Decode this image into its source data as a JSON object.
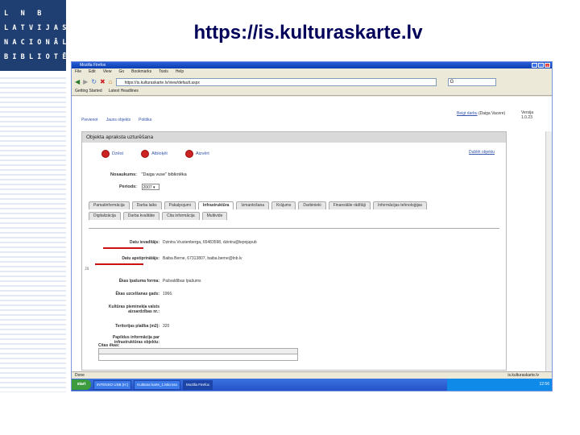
{
  "slide": {
    "title": "https://is.kulturaskarte.lv",
    "logo_lines": [
      "L N B",
      "LATVIJAS",
      "NACIONĀLĀ",
      "BIBLIOTĒKA"
    ]
  },
  "browser": {
    "window_title": "Mozilla Firefox",
    "menu": [
      "File",
      "Edit",
      "View",
      "Go",
      "Bookmarks",
      "Tools",
      "Help"
    ],
    "url": "https://is.kulturaskarte.lv/view/default.aspx",
    "search_placeholder": "G",
    "bookmarks": [
      "Getting Started",
      "Latest Headlines"
    ],
    "status_left": "Done",
    "status_right": "is.kulturaskarte.lv"
  },
  "page": {
    "nav_links": [
      "Pievienot",
      "Jauns objekts",
      "Politika"
    ],
    "user_logout": "Beigt darbu",
    "user_name": "(Daiga Vacere)",
    "version_label": "Versija",
    "version_value": "1.0.23",
    "panel_title": "Objekta apraksta uzturēšana",
    "actions": [
      "Dzēst",
      "Atbloķēt",
      "Aizvērt"
    ],
    "close_link": "Dublēt objektu",
    "name_label": "Nosaukums:",
    "name_value": "\"Daiga vuse\" bibliotēka",
    "period_label": "Periods:",
    "period_value": "2007",
    "tabs_row1": [
      "Pamatinformācija",
      "Darba laiks",
      "Pakalpojumi",
      "Infrastruktūra",
      "Izmantošana",
      "Krājums",
      "Darbinieki",
      "Finansiālie rādītāji",
      "Informācijas tehnoloģijas"
    ],
    "tabs_row2": [
      "Digitalizācija",
      "Darba kvalitāte",
      "Cita informācija",
      "Multivide"
    ],
    "active_tab": "Infrastruktūra",
    "fields": [
      {
        "label": "Datu ievadītājs:",
        "value": "Dzintra Vrustenberga, 65483598, dzintra@lepojupub"
      },
      {
        "label": "Datu apstiprinātājs:",
        "value": "Baiba Berne, 67313807, baiba.berne@lnb.lv"
      },
      {
        "label": "Ēkas īpašuma forma:",
        "value": "Pašvaldības īpašums"
      },
      {
        "label": "Ēkas uzcelšanas gads:",
        "value": "1966."
      },
      {
        "label": "Kultūras pieminekļa valsts aizsardzības nr.:",
        "value": ""
      },
      {
        "label": "Teritorijas platība (m2):",
        "value": "320"
      },
      {
        "label": "Papildus informācija par infrastruktūras objektu:",
        "value": ""
      },
      {
        "label": "Citas ēkas:",
        "value": ""
      }
    ],
    "small_note": "Jā"
  },
  "taskbar": {
    "start": "start",
    "tasks": [
      "INTENSO USB (H:)",
      "Kultūras karte_1.Microso",
      "Mozilla Firefox"
    ],
    "tray_time": "12:56"
  },
  "colors": {
    "logo_bg": "#1f3f72",
    "title": "#00005a",
    "red_underline": "#cc1111",
    "taskbar": "#2452c8"
  }
}
